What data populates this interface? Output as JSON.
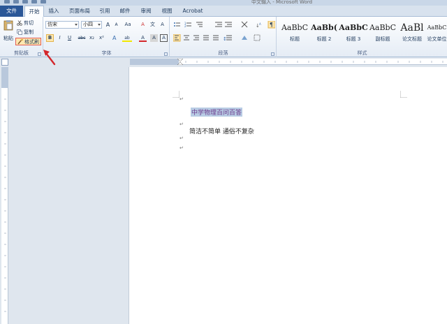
{
  "window": {
    "title": "中文输入 - Microsoft Word"
  },
  "tabs": [
    {
      "label": "文件"
    },
    {
      "label": "开始"
    },
    {
      "label": "插入"
    },
    {
      "label": "页面布局"
    },
    {
      "label": "引用"
    },
    {
      "label": "邮件"
    },
    {
      "label": "审阅"
    },
    {
      "label": "视图"
    },
    {
      "label": "Acrobat"
    }
  ],
  "clipboard": {
    "paste": "粘贴",
    "cut": "剪切",
    "copy": "复制",
    "format_painter": "格式刷",
    "group_label": "剪贴板"
  },
  "font": {
    "name": "仿宋",
    "size": "小四",
    "group_label": "字体",
    "bold": "B",
    "italic": "I",
    "underline": "U",
    "strike": "abc",
    "subscript": "x₂",
    "superscript": "x²",
    "grow": "A",
    "shrink": "A",
    "case": "Aa",
    "clear": "A",
    "phonetic": "文",
    "color": "A",
    "highlight": "ab",
    "border_char": "A"
  },
  "paragraph": {
    "group_label": "段落"
  },
  "styles": {
    "group_label": "样式",
    "items": [
      {
        "sample": "AaBbC",
        "name": "标题"
      },
      {
        "sample": "AaBb(",
        "name": "标题 2"
      },
      {
        "sample": "AaBbC",
        "name": "标题 3"
      },
      {
        "sample": "AaBbC",
        "name": "副标题"
      },
      {
        "sample": "AaBl",
        "name": "论文标题"
      },
      {
        "sample": "AaBbC",
        "name": "论文单位"
      }
    ]
  },
  "document": {
    "line1": "中学物理百问百答",
    "line2": "简洁不简单 通俗不复杂",
    "para_mark": "↵"
  },
  "colors": {
    "accent": "#2b5797",
    "highlight_box": "#e25b52",
    "selection": "#b8cce4",
    "arrow": "#d3262b"
  }
}
